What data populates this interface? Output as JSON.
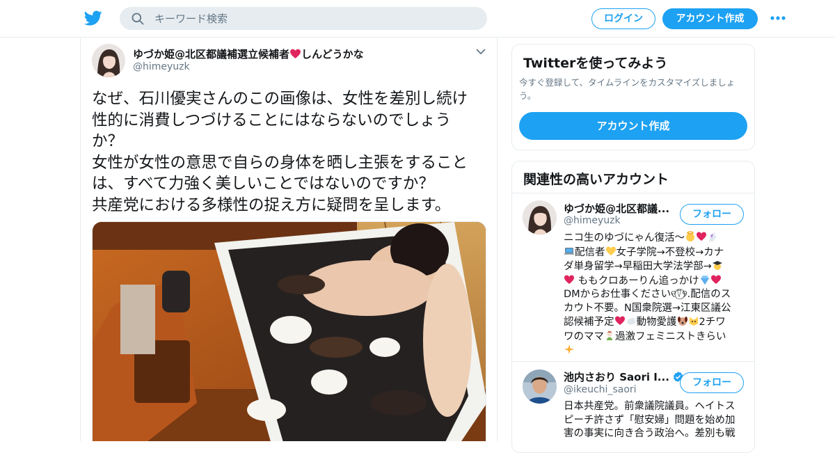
{
  "colors": {
    "accent": "#1da1f2",
    "text": "#14171a",
    "secondary": "#657786",
    "border": "#e6ecf0",
    "heart": "#e0245e"
  },
  "header": {
    "logo_icon": "twitter-bird-icon",
    "search_placeholder": "キーワード検索",
    "login_label": "ログイン",
    "signup_label": "アカウント作成",
    "more_icon": "more-dots-icon"
  },
  "tweet": {
    "author_name": "ゆづか姫@北区都議補選立候補者",
    "author_name_suffix": "しんどうかな",
    "author_handle": "@himeyuzk",
    "text": "なぜ、石川優実さんのこの画像は、女性を差別し続け\n性的に消費しつづけることにはならないのでしょう\nか？\n女性が女性の意思で自らの身体を晒し主張をすること\nは、すべて力強く美しいことではないのですか？\n共産党における多様性の捉え方に疑問を呈します。"
  },
  "sidebar": {
    "try_title": "Twitterを使ってみよう",
    "try_desc": "今すぐ登録して、タイムラインをカスタマイズしましょう。",
    "try_button": "アカウント作成",
    "related_title": "関連性の高いアカウント",
    "follow_label": "フォロー",
    "accounts": [
      {
        "name": "ゆづか姫@北区都議...",
        "handle": "@himeyuzk",
        "bio": [
          [
            "ニコ生のゆづにゃん復活〜",
            "{angel}",
            "{heart}",
            "{unicorn}"
          ],
          [
            "{laptop}",
            "配信者",
            "{yellowheart}",
            "女子学院→不登校→カナ"
          ],
          [
            "ダ単身留学→早稲田大学法学部→",
            "{graduate}"
          ],
          [
            "{heart}",
            " ももクロあーりん追っかけ",
            "{gem}",
            "{heart}"
          ],
          [
            "DMからお仕事ください୧⍢⃝୨.配信のス"
          ],
          [
            "カウト不要。N国衆院選→江東区議公"
          ],
          [
            "認候補予定",
            "{heart}",
            "{cloud}",
            "動物愛護",
            "{dog}",
            "{cat}",
            "2チワ"
          ],
          [
            "ワのママ",
            "{genie}",
            "過激フェミニストきらい"
          ],
          [
            "{sparkles}"
          ]
        ]
      },
      {
        "name": "池内さおり Saori I...",
        "handle": "@ikeuchi_saori",
        "verified": true,
        "bio": [
          [
            "日本共産党。前衆議院議員。ヘイトス"
          ],
          [
            "ピーチ許さず「慰安婦」問題を始め加"
          ],
          [
            "害の事実に向き合う政治へ。差別も戦"
          ]
        ]
      }
    ]
  }
}
